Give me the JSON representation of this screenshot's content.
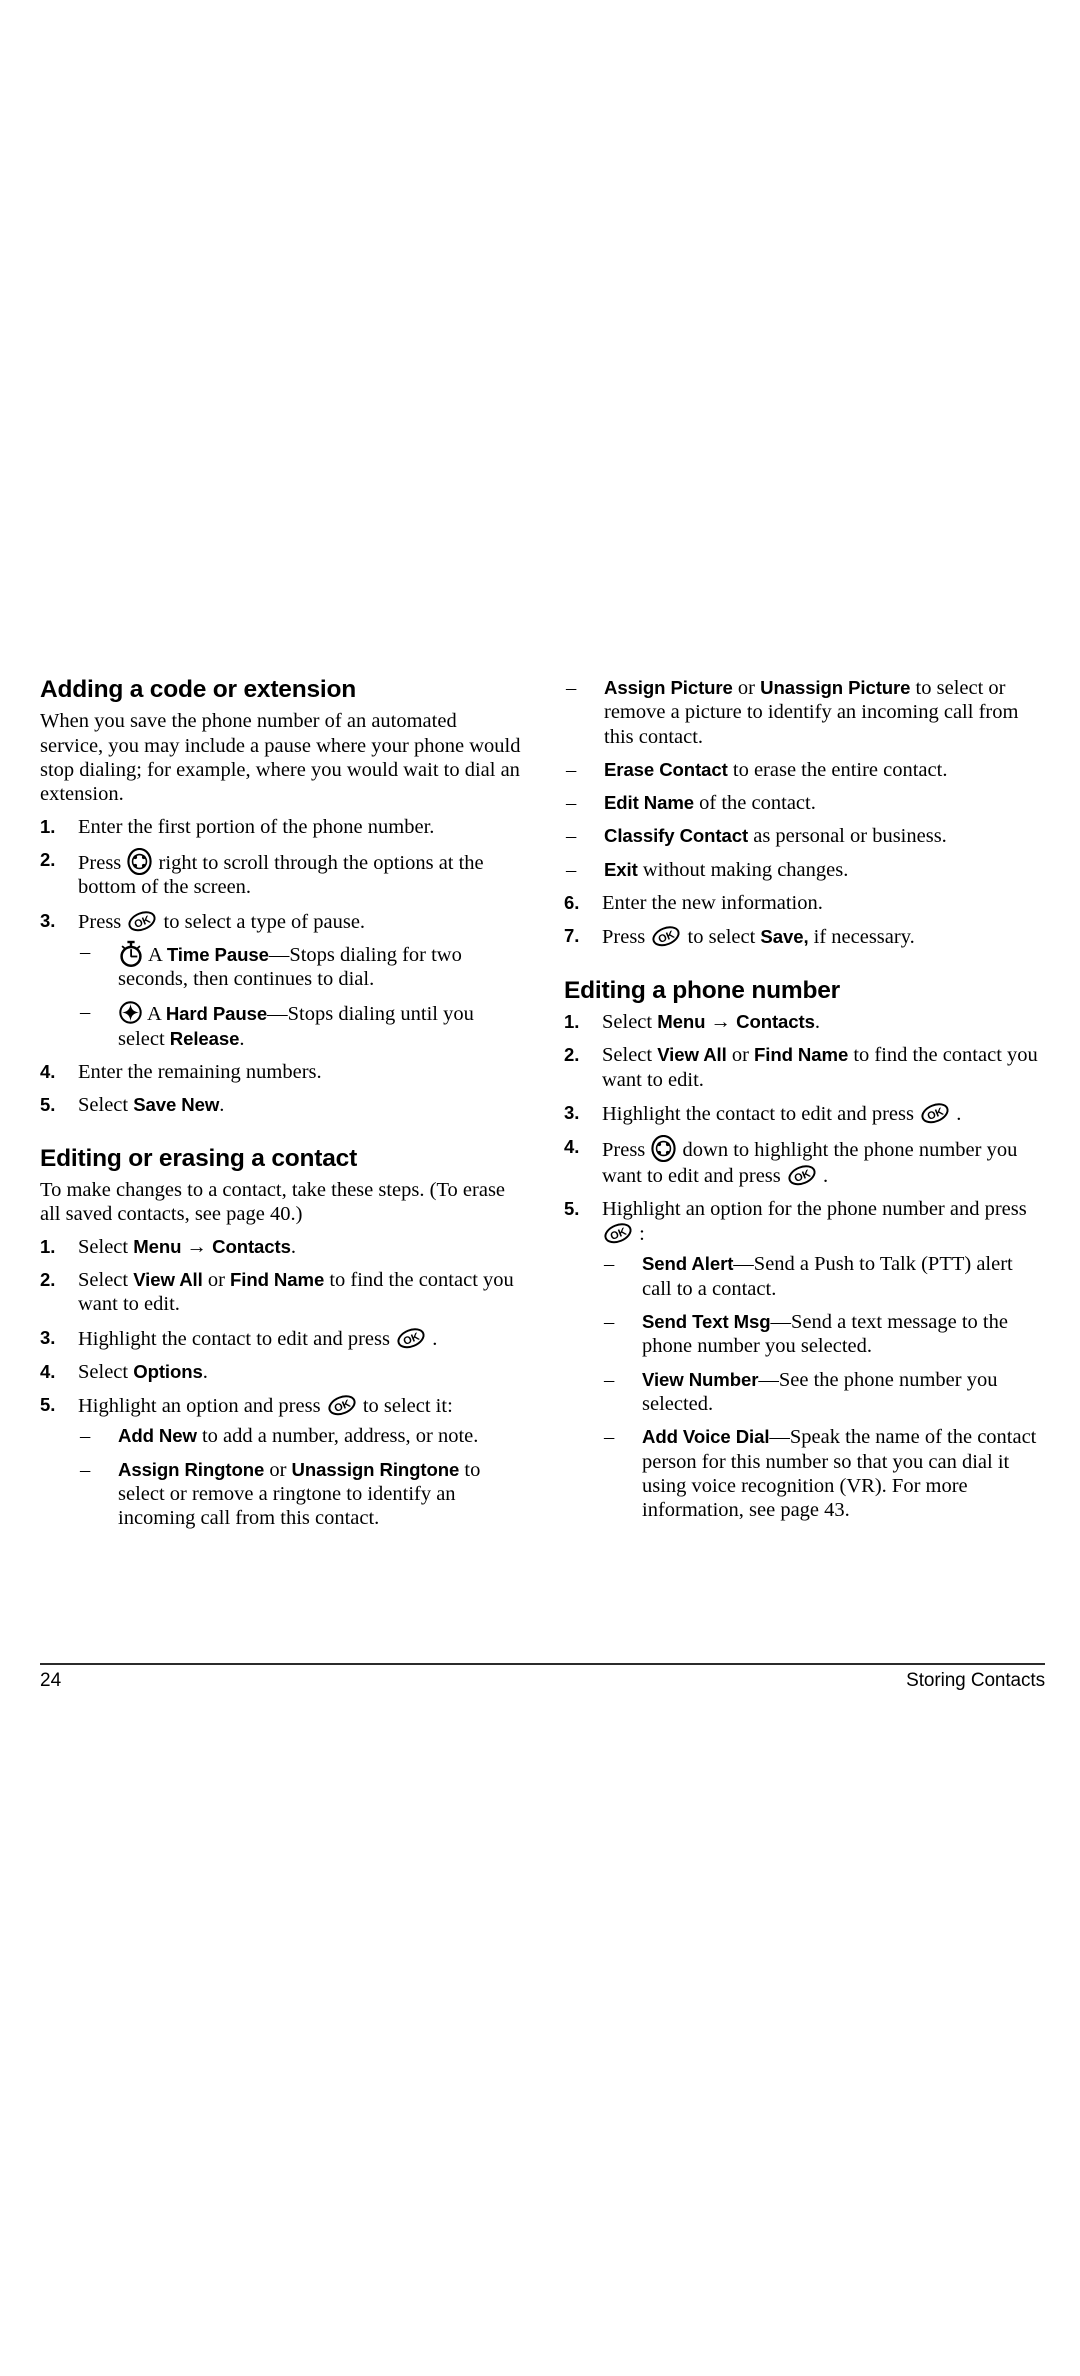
{
  "page": {
    "number": "24",
    "running_title": "Storing Contacts"
  },
  "icons": {
    "nav_key": "navigation-key-icon",
    "ok_key": "ok-key-icon",
    "time_pause": "stopwatch-icon",
    "hard_pause": "star-circle-icon"
  },
  "left_column": {
    "section1": {
      "heading": "Adding a code or extension",
      "intro": "When you save the phone number of an automated service, you may include a pause where your phone would stop dialing; for example, where you would wait to dial an extension.",
      "steps": [
        {
          "num": "1.",
          "pre": "Enter the first portion of the phone number.",
          "post": ""
        },
        {
          "num": "2.",
          "pre": "Press ",
          "icon": "nav",
          "post": " right to scroll through the options at the bottom of the screen."
        },
        {
          "num": "3.",
          "pre": "Press ",
          "icon": "ok",
          "post": " to select a type of pause.",
          "sub": [
            {
              "icon": "time",
              "pre": "A ",
              "term": "Time Pause",
              "post": "—Stops dialing for two seconds, then continues to dial."
            },
            {
              "icon": "hard",
              "pre": "A ",
              "term": "Hard Pause",
              "post": "—Stops dialing until you select ",
              "term2": "Release",
              "post2": "."
            }
          ]
        },
        {
          "num": "4.",
          "pre": "Enter the remaining numbers.",
          "post": ""
        },
        {
          "num": "5.",
          "pre": "Select ",
          "term": "Save New",
          "post": "."
        }
      ]
    },
    "section2": {
      "heading": "Editing or erasing a contact",
      "intro": "To make changes to a contact, take these steps. (To erase all saved contacts, see page 40.)",
      "steps": [
        {
          "num": "1.",
          "pre": "Select ",
          "term": "Menu",
          "mid": " → ",
          "term2": "Contacts",
          "post": "."
        },
        {
          "num": "2.",
          "pre": "Select ",
          "term": "View All",
          "mid": " or ",
          "term2": "Find Name",
          "post": " to find the contact you want to edit."
        },
        {
          "num": "3.",
          "pre": "Highlight the contact to edit and press ",
          "icon": "ok",
          "post": " ."
        },
        {
          "num": "4.",
          "pre": "Select ",
          "term": "Options",
          "post": "."
        },
        {
          "num": "5.",
          "pre": "Highlight an option and press ",
          "icon": "ok",
          "post": " to select it:",
          "sub": [
            {
              "term": "Add New",
              "post": " to add a number, address, or note."
            },
            {
              "term": "Assign Ringtone",
              "mid": " or ",
              "term2": "Unassign Ringtone",
              "post": " to select or remove a ringtone to identify an incoming call from this contact."
            }
          ]
        }
      ]
    }
  },
  "right_column": {
    "continued_sub": [
      {
        "term": "Assign Picture",
        "mid": " or ",
        "term2": "Unassign Picture",
        "post": " to select or remove a picture to identify an incoming call from this contact."
      },
      {
        "term": "Erase Contact",
        "post": " to erase the entire contact."
      },
      {
        "term": "Edit Name",
        "post": " of the contact."
      },
      {
        "term": "Classify Contact",
        "post": " as personal or business."
      },
      {
        "term": "Exit",
        "post": " without making changes."
      }
    ],
    "continued_steps": [
      {
        "num": "6.",
        "pre": "Enter the new information.",
        "post": ""
      },
      {
        "num": "7.",
        "pre": "Press ",
        "icon": "ok",
        "post": " to select ",
        "term": "Save,",
        "post2": " if necessary."
      }
    ],
    "section3": {
      "heading": "Editing a phone number",
      "steps": [
        {
          "num": "1.",
          "pre": "Select ",
          "term": "Menu",
          "mid": " → ",
          "term2": "Contacts",
          "post": "."
        },
        {
          "num": "2.",
          "pre": "Select ",
          "term": "View All",
          "mid": " or ",
          "term2": "Find Name",
          "post": " to find the contact you want to edit."
        },
        {
          "num": "3.",
          "pre": "Highlight the contact to edit and press ",
          "icon": "ok",
          "post": " ."
        },
        {
          "num": "4.",
          "pre": "Press ",
          "icon": "nav",
          "post": " down to highlight the phone number you want to edit and press ",
          "icon2": "ok",
          "post2": " ."
        },
        {
          "num": "5.",
          "pre": "Highlight an option for the phone number and press ",
          "icon": "ok",
          "post": " :",
          "sub": [
            {
              "term": "Send Alert",
              "post": "—Send a Push to Talk (PTT) alert call to a contact."
            },
            {
              "term": "Send Text Msg",
              "post": "—Send a text message to the phone number you selected."
            },
            {
              "term": "View Number",
              "post": "—See the phone number you selected."
            },
            {
              "term": "Add Voice Dial",
              "post": "—Speak the name of the contact person for this number so that you can dial it using voice recognition (VR). For more information, see page 43."
            }
          ]
        }
      ]
    }
  }
}
